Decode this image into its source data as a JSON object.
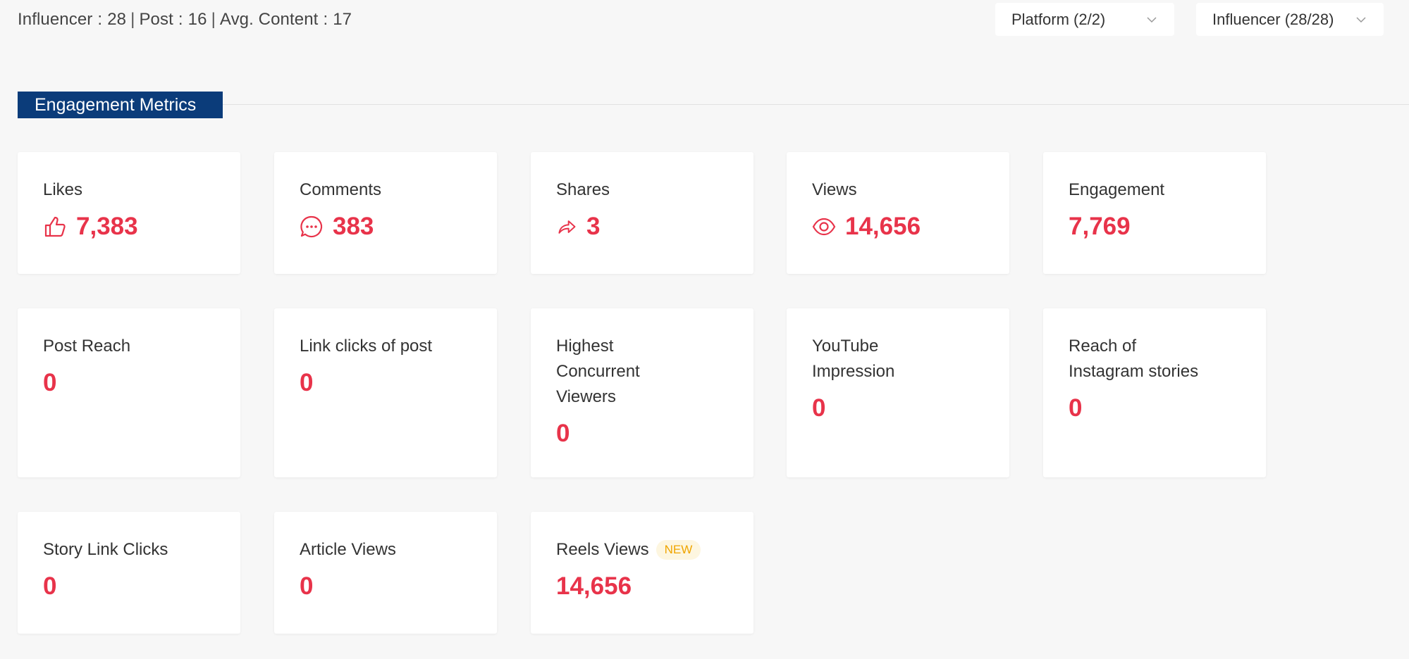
{
  "summary": {
    "influencer_label": "Influencer",
    "influencer_value": "28",
    "post_label": "Post",
    "post_value": "16",
    "avg_label": "Avg. Content",
    "avg_value": "17"
  },
  "filters": {
    "platform": "Platform (2/2)",
    "influencer": "Influencer (28/28)"
  },
  "section": {
    "title": "Engagement Metrics"
  },
  "metrics": [
    {
      "label": "Likes",
      "value": "7,383",
      "icon": "thumbs-up-icon"
    },
    {
      "label": "Comments",
      "value": "383",
      "icon": "comment-icon"
    },
    {
      "label": "Shares",
      "value": "3",
      "icon": "share-icon"
    },
    {
      "label": "Views",
      "value": "14,656",
      "icon": "eye-icon"
    },
    {
      "label": "Engagement",
      "value": "7,769"
    },
    {
      "label": "Post Reach",
      "value": "0"
    },
    {
      "label": "Link clicks of post",
      "value": "0"
    },
    {
      "label_lines": [
        "Highest",
        "Concurrent",
        "Viewers"
      ],
      "value": "0"
    },
    {
      "label_lines": [
        "YouTube",
        "Impression"
      ],
      "value": "0"
    },
    {
      "label_lines": [
        "Reach of",
        "Instagram stories"
      ],
      "value": "0"
    },
    {
      "label": "Story Link Clicks",
      "value": "0"
    },
    {
      "label": "Article Views",
      "value": "0"
    },
    {
      "label": "Reels Views",
      "value": "14,656",
      "badge": "NEW"
    }
  ],
  "colors": {
    "accent_value": "#e8334a",
    "section_tag": "#0b3c7a",
    "badge_text": "#f0a500",
    "badge_bg": "#fdf6e0"
  }
}
